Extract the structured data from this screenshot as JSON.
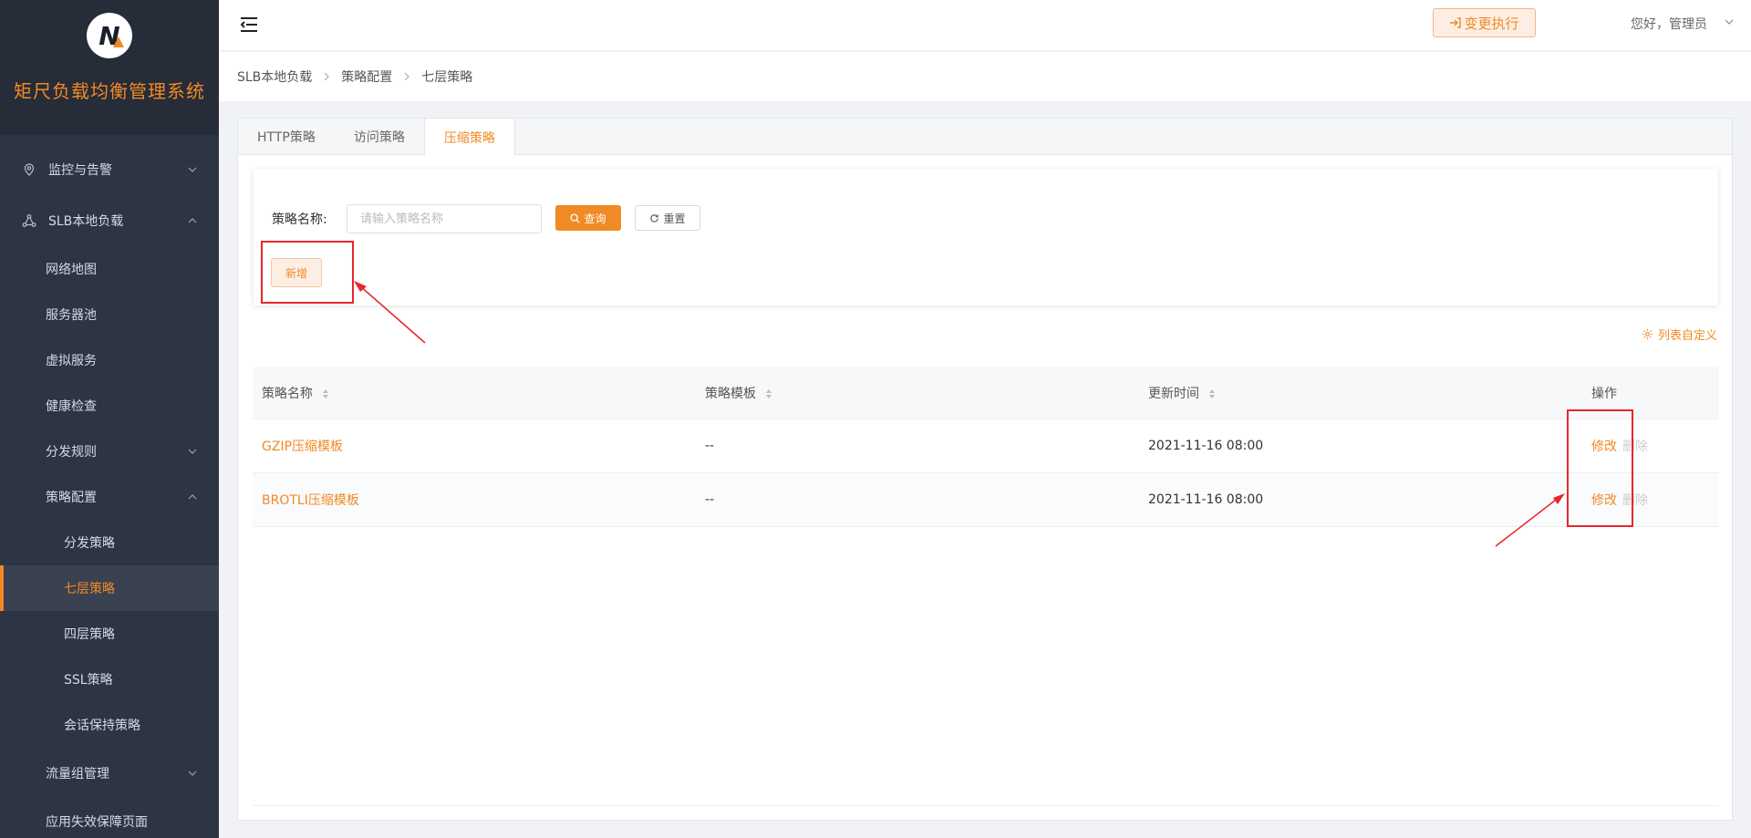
{
  "brand": {
    "title": "矩尺负载均衡管理系统",
    "logo_letter": "N"
  },
  "sidebar": {
    "items": [
      {
        "label": "监控与告警",
        "icon": "location-icon",
        "level": 1,
        "chevron": "down"
      },
      {
        "label": "SLB本地负载",
        "icon": "share-nodes-icon",
        "level": 1,
        "chevron": "up"
      },
      {
        "label": "网络地图",
        "level": 2
      },
      {
        "label": "服务器池",
        "level": 2
      },
      {
        "label": "虚拟服务",
        "level": 2
      },
      {
        "label": "健康检查",
        "level": 2
      },
      {
        "label": "分发规则",
        "level": 2,
        "chevron": "down"
      },
      {
        "label": "策略配置",
        "level": 2,
        "chevron": "up"
      },
      {
        "label": "分发策略",
        "level": 3
      },
      {
        "label": "七层策略",
        "level": 3,
        "active": true
      },
      {
        "label": "四层策略",
        "level": 3
      },
      {
        "label": "SSL策略",
        "level": 3
      },
      {
        "label": "会话保持策略",
        "level": 3
      },
      {
        "label": "流量组管理",
        "level": 2,
        "chevron": "down"
      },
      {
        "label": "应用失效保障页面",
        "level": 2
      }
    ]
  },
  "header": {
    "exec_button": "变更执行",
    "greeting": "您好，管理员"
  },
  "breadcrumb": [
    "SLB本地负载",
    "策略配置",
    "七层策略"
  ],
  "tabs": [
    {
      "label": "HTTP策略",
      "active": false
    },
    {
      "label": "访问策略",
      "active": false
    },
    {
      "label": "压缩策略",
      "active": true
    }
  ],
  "search": {
    "label": "策略名称:",
    "placeholder": "请输入策略名称",
    "value": "",
    "query_button": "查询",
    "reset_button": "重置",
    "add_button": "新增"
  },
  "toolbar": {
    "customize_columns": "列表自定义"
  },
  "table": {
    "headers": [
      "策略名称",
      "策略模板",
      "更新时间",
      "操作"
    ],
    "rows": [
      {
        "name": "GZIP压缩模板",
        "template": "--",
        "updated": "2021-11-16 08:00",
        "edit": "修改",
        "delete": "删除"
      },
      {
        "name": "BROTLI压缩模板",
        "template": "--",
        "updated": "2021-11-16 08:00",
        "edit": "修改",
        "delete": "删除"
      }
    ]
  },
  "colors": {
    "accent": "#f08a24",
    "sidebar_bg": "#2d3443",
    "annotation": "#e8262b"
  }
}
